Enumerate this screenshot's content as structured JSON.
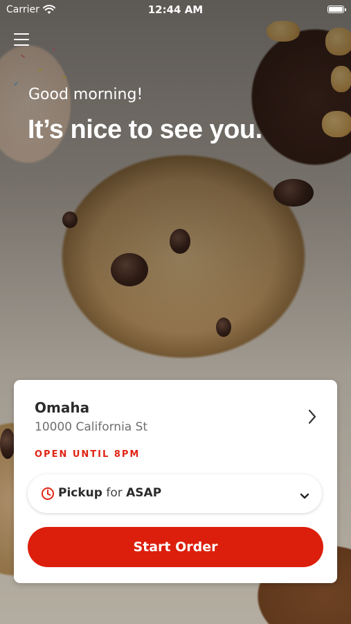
{
  "status_bar": {
    "carrier": "Carrier",
    "time": "12:44 AM"
  },
  "header": {
    "menu_icon": "hamburger-menu-icon",
    "greeting": "Good morning!",
    "headline": "It’s nice to see you."
  },
  "location": {
    "name": "Omaha",
    "address": "10000 California St",
    "status": "OPEN UNTIL 8PM"
  },
  "order_type": {
    "method": "Pickup",
    "connector": "for",
    "when": "ASAP"
  },
  "start_button": {
    "label": "Start Order"
  },
  "colors": {
    "accent_red": "#dc1f0c",
    "status_red": "#e02414",
    "text_dark": "#2b2b2b",
    "text_muted": "#6e6e6e"
  }
}
